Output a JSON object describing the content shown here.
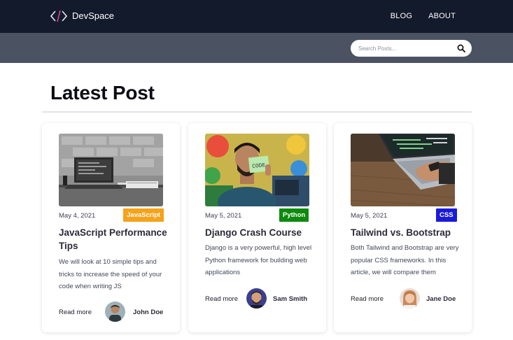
{
  "brand": {
    "name": "DevSpace",
    "logo_icon": "code-brackets-icon"
  },
  "nav": {
    "links": [
      "BLOG",
      "ABOUT"
    ]
  },
  "search": {
    "placeholder": "Search Posts...",
    "icon": "search-icon"
  },
  "page": {
    "title": "Latest Post"
  },
  "posts": [
    {
      "date": "May 4, 2021",
      "category": "JavaScript",
      "category_color": "#f6a21a",
      "title": "JavaScript Performance Tips",
      "excerpt": "We will look at 10 simple tips and tricks to increase the speed of your code when writing JS",
      "read_more": "Read more",
      "author": "John Doe"
    },
    {
      "date": "May 5, 2021",
      "category": "Python",
      "category_color": "#0d8a0d",
      "title": "Django Crash Course",
      "excerpt": "Django is a very powerful, high level Python framework for building web applications",
      "read_more": "Read more",
      "author": "Sam Smith"
    },
    {
      "date": "May 5, 2021",
      "category": "CSS",
      "category_color": "#1a1ad8",
      "title": "Tailwind vs. Bootstrap",
      "excerpt": "Both Tailwind and Bootstrap are very popular CSS frameworks. In this article, we will compare them",
      "read_more": "Read more",
      "author": "Jane Doe"
    }
  ]
}
